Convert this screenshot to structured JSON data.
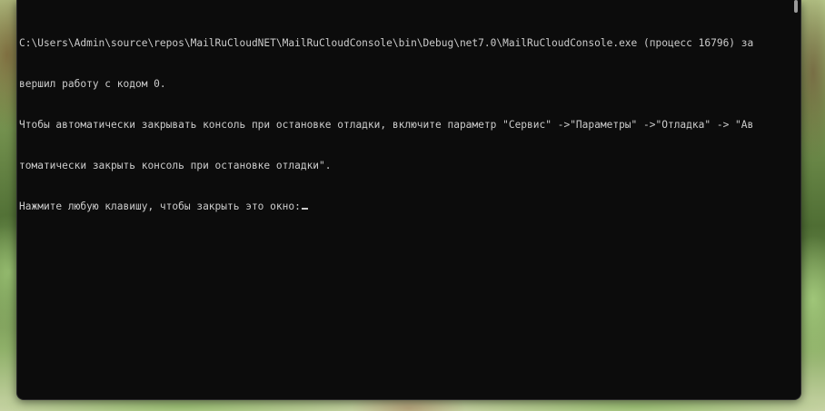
{
  "window": {
    "type": "console",
    "background_color": "#0c0c0c",
    "text_color": "#cccccc"
  },
  "console": {
    "lines": [
      "C:\\Users\\Admin\\source\\repos\\MailRuCloudNET\\MailRuCloudConsole\\bin\\Debug\\net7.0\\MailRuCloudConsole.exe (процесс 16796) за",
      "вершил работу с кодом 0.",
      "Чтобы автоматически закрывать консоль при остановке отладки, включите параметр \"Сервис\" ->\"Параметры\" ->\"Отладка\" -> \"Ав",
      "томатически закрыть консоль при остановке отладки\".",
      "Нажмите любую клавишу, чтобы закрыть это окно:"
    ]
  },
  "wallpaper": {
    "description_colors": [
      "#b7c98a",
      "#7d9a55",
      "#4f6e34",
      "#8fb069"
    ]
  }
}
